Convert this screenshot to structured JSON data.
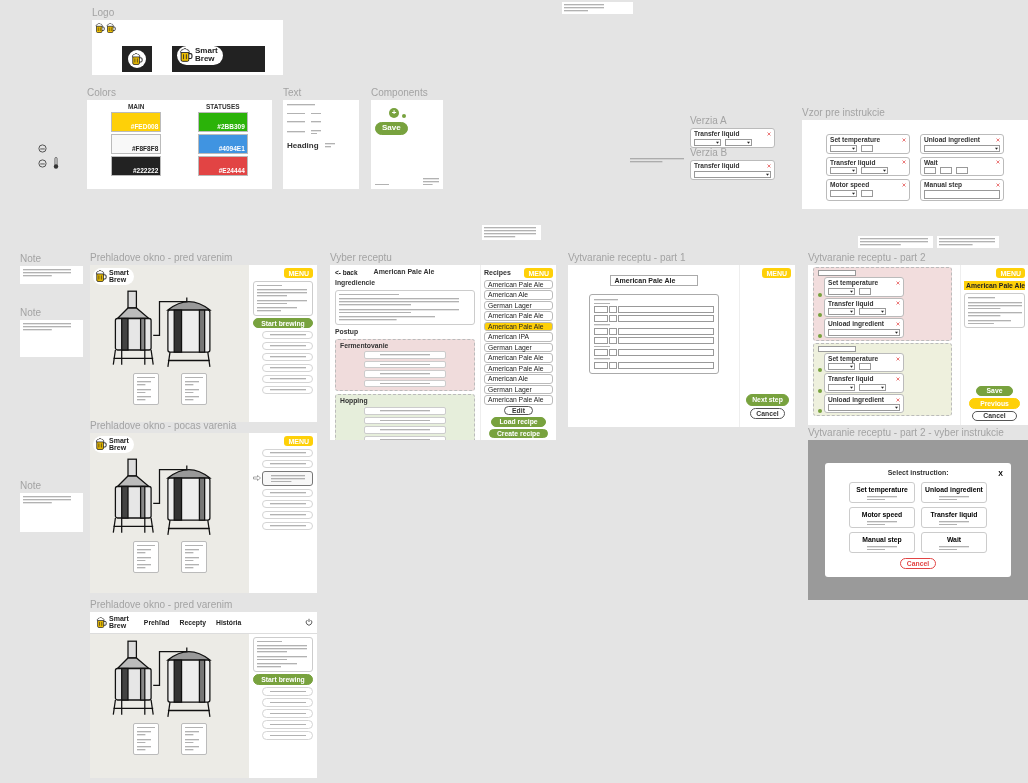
{
  "frames": [
    {
      "kind": "logo",
      "title": "Logo",
      "brand": [
        "Smart",
        "Brew"
      ]
    },
    {
      "kind": "colors",
      "title": "Colors",
      "groups": [
        {
          "heading": "MAIN",
          "swatches": [
            {
              "code": "#FED008",
              "color": "#fed008"
            },
            {
              "code": "#F8F8F8",
              "color": "#f8f8f8"
            },
            {
              "code": "#222222",
              "color": "#222222"
            }
          ]
        },
        {
          "heading": "STATUSES",
          "swatches": [
            {
              "code": "#2BB309",
              "color": "#2bb309"
            },
            {
              "code": "#4094E1",
              "color": "#4094e1"
            },
            {
              "code": "#E24444",
              "color": "#e24444"
            }
          ]
        }
      ]
    },
    {
      "kind": "text",
      "title": "Text",
      "sample": "Heading"
    },
    {
      "kind": "components",
      "title": "Components",
      "add_glyph": "+",
      "button": "Save"
    },
    {
      "kind": "version",
      "title": "Verzia A",
      "card": {
        "title": "Transfer liquid",
        "parts": [
          {
            "kind": "select"
          },
          {
            "kind": "select"
          }
        ]
      }
    },
    {
      "kind": "version",
      "title": "Verzia B",
      "card": {
        "title": "Transfer liquid",
        "parts": [
          {
            "kind": "select"
          }
        ]
      }
    },
    {
      "kind": "templates",
      "title": "Vzor pre instrukcie",
      "cards": [
        {
          "title": "Set temperature",
          "parts": [
            {
              "kind": "select"
            },
            {
              "kind": "input"
            }
          ]
        },
        {
          "title": "Unload ingredient",
          "parts": [
            {
              "kind": "select"
            }
          ]
        },
        {
          "title": "Transfer liquid",
          "parts": [
            {
              "kind": "select"
            },
            {
              "kind": "select"
            }
          ]
        },
        {
          "title": "Wait",
          "parts": [
            {
              "kind": "input"
            },
            {
              "kind": "input"
            },
            {
              "kind": "input"
            }
          ]
        },
        {
          "title": "Motor speed",
          "parts": [
            {
              "kind": "select"
            },
            {
              "kind": "input"
            }
          ]
        },
        {
          "title": "Manual step",
          "parts": [
            {
              "kind": "area"
            }
          ]
        }
      ]
    },
    {
      "kind": "note",
      "title": "Note"
    },
    {
      "kind": "overview",
      "title": "Prehladove okno - pred varenim",
      "brand": [
        "Smart",
        "Brew"
      ],
      "menu": "MENU",
      "ingredients": true,
      "start": "Start brewing",
      "steps": [
        {
          "kind": "row",
          "current": false
        },
        {
          "kind": "row",
          "current": false
        },
        {
          "kind": "row",
          "current": false
        },
        {
          "kind": "row",
          "current": false
        },
        {
          "kind": "row",
          "current": false
        },
        {
          "kind": "row",
          "current": false
        }
      ]
    },
    {
      "kind": "recipe_select",
      "title": "Vyber receptu",
      "back": "<- back",
      "name": "American Pale Ale",
      "ingredients_label": "Ingrediencie",
      "procedure_label": "Postup",
      "sections": [
        {
          "name": "Fermentovanie",
          "color": "#f0dcdc"
        },
        {
          "name": "Hopping",
          "color": "#e6eedb"
        }
      ],
      "recipes_heading": "Recipes",
      "menu": "MENU",
      "recipes": [
        {
          "label": "American Pale Ale",
          "selected": false
        },
        {
          "label": "American Ale",
          "selected": false
        },
        {
          "label": "German Lager",
          "selected": false
        },
        {
          "label": "American Pale Ale",
          "selected": false
        },
        {
          "label": "American Pale Ale",
          "selected": true
        },
        {
          "label": "American IPA",
          "selected": false
        },
        {
          "label": "German Lager",
          "selected": false
        },
        {
          "label": "American Pale Ale",
          "selected": false
        },
        {
          "label": "American Pale Ale",
          "selected": false
        },
        {
          "label": "American Ale",
          "selected": false
        },
        {
          "label": "German Lager",
          "selected": false
        },
        {
          "label": "American Pale Ale",
          "selected": false
        }
      ],
      "buttons": [
        {
          "label": "Edit",
          "kind": "outline"
        },
        {
          "label": "Load recipe",
          "kind": "primary"
        },
        {
          "label": "Create recipe",
          "kind": "primary"
        }
      ]
    },
    {
      "kind": "recipe_part1",
      "title": "Vytvaranie receptu - part 1",
      "name": "American Pale Ale",
      "menu": "MENU",
      "buttons": [
        {
          "label": "Next step",
          "kind": "primary"
        },
        {
          "label": "Cancel",
          "kind": "outline"
        }
      ]
    },
    {
      "kind": "recipe_part2",
      "title": "Vytvaranie receptu - part 2",
      "menu": "MENU",
      "name": "American Pale Ale",
      "sections": [
        {
          "color": "#f2dddd",
          "cards": [
            {
              "title": "Set temperature",
              "parts": [
                {
                  "kind": "select"
                },
                {
                  "kind": "input"
                }
              ]
            },
            {
              "title": "Transfer liquid",
              "parts": [
                {
                  "kind": "select"
                },
                {
                  "kind": "select"
                }
              ]
            },
            {
              "title": "Unload ingredient",
              "parts": [
                {
                  "kind": "select"
                }
              ]
            }
          ]
        },
        {
          "color": "#eef0dd",
          "cards": [
            {
              "title": "Set temperature",
              "parts": [
                {
                  "kind": "select"
                },
                {
                  "kind": "input"
                }
              ]
            },
            {
              "title": "Transfer liquid",
              "parts": [
                {
                  "kind": "select"
                },
                {
                  "kind": "select"
                }
              ]
            },
            {
              "title": "Unload ingredient",
              "parts": [
                {
                  "kind": "select"
                }
              ]
            }
          ]
        }
      ],
      "buttons": [
        {
          "label": "Save",
          "kind": "primary"
        },
        {
          "label": "Previous",
          "kind": "warning"
        },
        {
          "label": "Cancel",
          "kind": "outline"
        }
      ]
    },
    {
      "kind": "note",
      "title": "Note"
    },
    {
      "kind": "overview",
      "title": "Prehladove okno - pocas varenia",
      "brand": [
        "Smart",
        "Brew"
      ],
      "menu": "MENU",
      "steps": [
        {
          "kind": "row",
          "current": false
        },
        {
          "kind": "row",
          "current": false
        },
        {
          "kind": "active",
          "current": true
        },
        {
          "kind": "row",
          "current": false
        },
        {
          "kind": "row",
          "current": false
        },
        {
          "kind": "row",
          "current": false
        },
        {
          "kind": "row",
          "current": false
        }
      ]
    },
    {
      "kind": "instruction_dialog",
      "title": "Vytvaranie receptu - part 2 - vyber instrukcie",
      "heading": "Select instruction:",
      "close": "X",
      "options": [
        {
          "title": "Set temperature"
        },
        {
          "title": "Unload ingredient"
        },
        {
          "title": "Motor speed"
        },
        {
          "title": "Transfer liquid"
        },
        {
          "title": "Manual step"
        },
        {
          "title": "Wait"
        }
      ],
      "cancel": "Cancel"
    },
    {
      "kind": "note",
      "title": "Note"
    },
    {
      "kind": "overview",
      "title": "Prehladove okno - pred varenim",
      "brand": [
        "Smart",
        "Brew"
      ],
      "nav": [
        "Prehľad",
        "Recepty",
        "História"
      ],
      "ingredients": true,
      "start": "Start brewing",
      "steps": [
        {
          "kind": "row",
          "current": false
        },
        {
          "kind": "row",
          "current": false
        },
        {
          "kind": "row",
          "current": false
        },
        {
          "kind": "row",
          "current": false
        },
        {
          "kind": "row",
          "current": false
        }
      ]
    }
  ]
}
